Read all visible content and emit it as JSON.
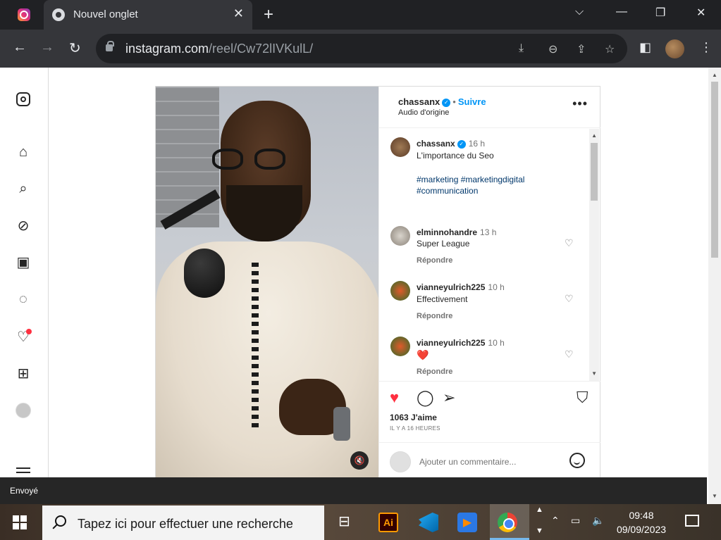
{
  "browser": {
    "tab_title": "Nouvel onglet",
    "url_domain": "instagram.com",
    "url_path": "/reel/Cw72lIVKulL/",
    "icons": [
      "instagram-favicon",
      "chrome-favicon",
      "close-icon",
      "plus-icon",
      "back-icon",
      "forward-icon",
      "reload-icon",
      "lock-icon",
      "install-icon",
      "zoom-icon",
      "share-icon",
      "star-icon",
      "side-panel-icon",
      "menu-icon"
    ]
  },
  "post": {
    "username": "chassanx",
    "follow_label": "Suivre",
    "audio": "Audio d'origine",
    "caption_time": "16 h",
    "caption_text": "L'importance du Seo",
    "hashtags_line1": "#marketing #marketingdigital",
    "hashtags_line2": "#communication",
    "comments": [
      {
        "user": "elminnohandre",
        "time": "13 h",
        "text": "Super League",
        "reply": "Répondre"
      },
      {
        "user": "vianneyulrich225",
        "time": "10 h",
        "text": "Effectivement",
        "reply": "Répondre"
      },
      {
        "user": "vianneyulrich225",
        "time": "10 h",
        "text": "❤️",
        "reply": "Répondre"
      }
    ],
    "likes": "1063 J'aime",
    "ago": "IL Y A 16 HEURES",
    "add_comment_placeholder": "Ajouter un commentaire..."
  },
  "toast": {
    "text": "Envoyé"
  },
  "taskbar": {
    "search_placeholder": "Tapez ici pour effectuer une recherche",
    "time": "09:48",
    "date": "09/09/2023",
    "ai_label": "Ai"
  },
  "colors": {
    "accent": "#0095f6",
    "like": "#ff3040",
    "chrome_dark": "#202124"
  }
}
